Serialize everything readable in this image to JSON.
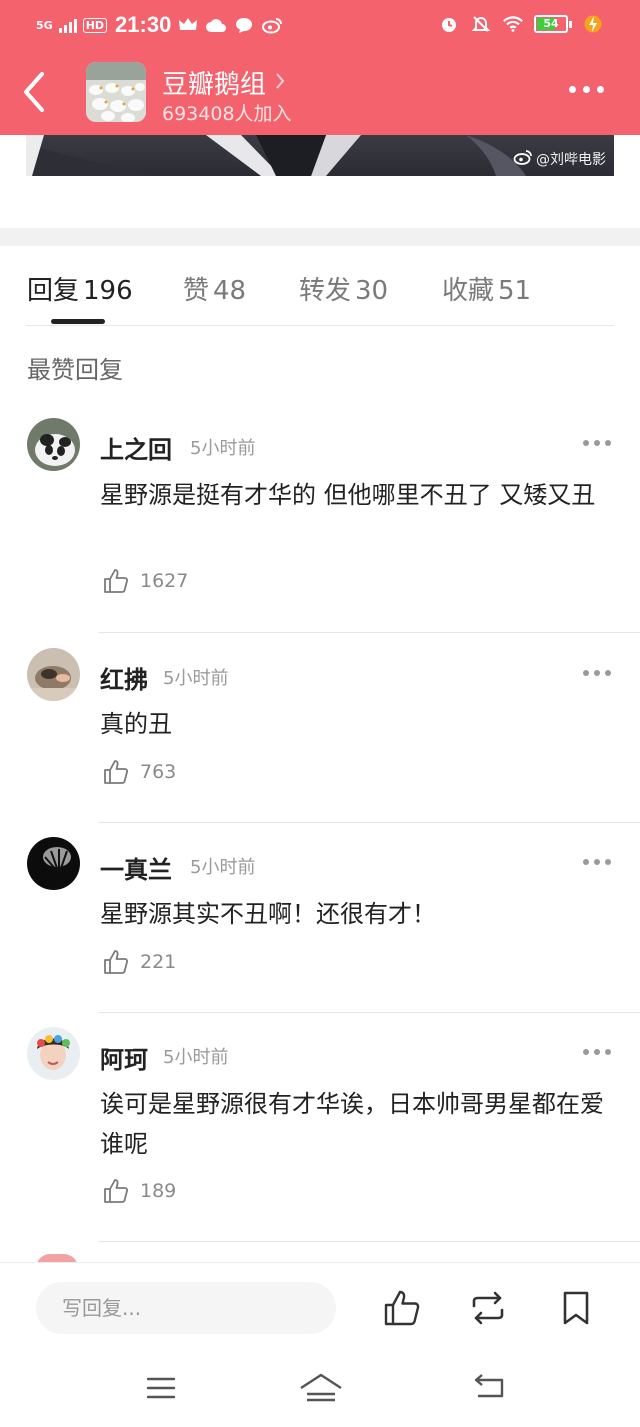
{
  "status_bar": {
    "network": "5G",
    "hd": "HD",
    "time": "21:30",
    "battery": "54"
  },
  "header": {
    "group_name": "豆瓣鹅组",
    "member_count": "693408人加入"
  },
  "image": {
    "watermark": "@刘哔电影"
  },
  "tabs": [
    {
      "label": "回复",
      "count": "196"
    },
    {
      "label": "赞",
      "count": "48"
    },
    {
      "label": "转发",
      "count": "30"
    },
    {
      "label": "收藏",
      "count": "51"
    }
  ],
  "section_title": "最赞回复",
  "comments": [
    {
      "user": "上之回",
      "time": "5小时前",
      "text": "星野源是挺有才华的 但他哪里不丑了 又矮又丑",
      "likes": "1627"
    },
    {
      "user": "红拂",
      "time": "5小时前",
      "text": "真的丑",
      "likes": "763"
    },
    {
      "user": "一真兰",
      "time": "5小时前",
      "text": "星野源其实不丑啊！还很有才！",
      "likes": "221"
    },
    {
      "user": "阿珂",
      "time": "5小时前",
      "text": "诶可是星野源很有才华诶，日本帅哥男星都在爱谁呢",
      "likes": "189"
    }
  ],
  "bottom_bar": {
    "reply_placeholder": "写回复..."
  },
  "icons": [
    "back-icon",
    "chevron-right-icon",
    "more-icon",
    "weibo-icon",
    "thumb-up-icon",
    "repost-icon",
    "bookmark-icon",
    "menu-icon",
    "home-icon",
    "back-nav-icon"
  ],
  "colors": {
    "header": "#f4636d"
  }
}
